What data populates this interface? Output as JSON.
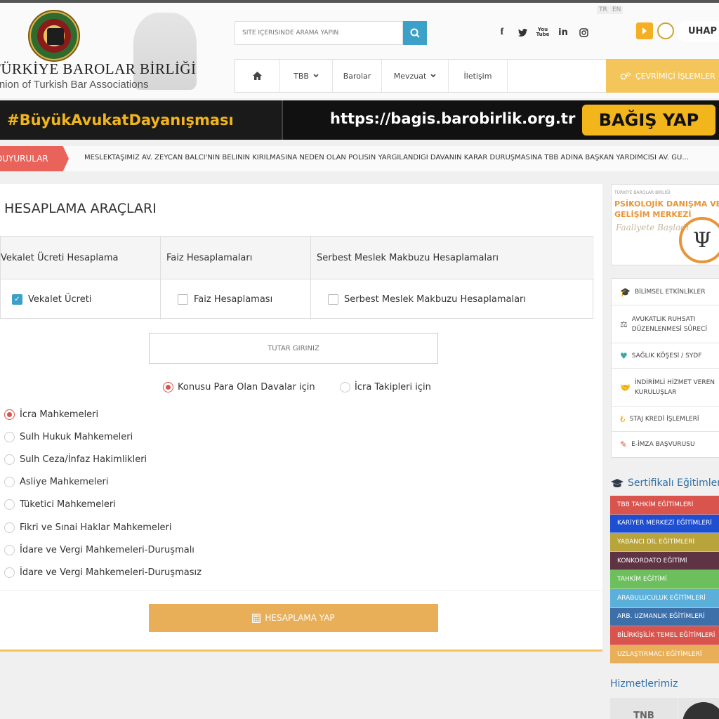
{
  "header": {
    "brand_title": "TÜRKİYE BAROLAR BİRLİĞİ",
    "brand_subtitle": "Union of Turkish Bar Associations",
    "lang": [
      "TR",
      "EN"
    ],
    "search_placeholder": "SİTE İÇERİSİNDE ARAMA YAPIN",
    "uhap_label": "UHAP GİRİŞ",
    "social_icons": [
      "facebook-icon",
      "twitter-icon",
      "youtube-icon",
      "linkedin-icon",
      "instagram-icon"
    ],
    "youtube_glyph": "You Tube",
    "linkedin_glyph": "in",
    "nav": [
      {
        "label": "",
        "icon": "home-icon"
      },
      {
        "label": "TBB",
        "dropdown": true
      },
      {
        "label": "Barolar"
      },
      {
        "label": "Mevzuat",
        "dropdown": true
      },
      {
        "label": "İletişim"
      }
    ],
    "online_label": "ÇEVRİMİÇİ İŞLEMLER"
  },
  "banner": {
    "hashtag": "#BüyükAvukatDayanışması",
    "url": "https://bagis.barobirlik.org.tr",
    "cta": "BAĞIŞ YAP"
  },
  "announcements": {
    "label": "DUYURULAR",
    "text": "MESLEKTAŞIMIZ AV. ZEYCAN BALCI'NIN BELİNİN KIRILMASINA NEDEN OLAN POLİSİN YARGILANDIĞI DAVANIN KARAR DURUŞMASINA TBB ADINA BAŞKAN YARDIMCISI AV. GÜ..."
  },
  "main": {
    "title": "HESAPLAMA ARAÇLARI",
    "columns": [
      "Vekalet Ücreti Hesaplama",
      "Faiz Hesaplamaları",
      "Serbest Meslek Makbuzu Hesaplamaları"
    ],
    "options": [
      {
        "label": "Vekalet Ücreti",
        "checked": true
      },
      {
        "label": "Faiz Hesaplaması",
        "checked": false
      },
      {
        "label": "Serbest Meslek Makbuzu Hesaplamaları",
        "checked": false
      }
    ],
    "amount_placeholder": "TUTAR GİRİNİZ",
    "case_types": [
      {
        "label": "Konusu Para Olan Davalar için",
        "selected": true
      },
      {
        "label": "İcra Takipleri için",
        "selected": false
      }
    ],
    "courts": [
      {
        "label": "İcra Mahkemeleri",
        "selected": true
      },
      {
        "label": "Sulh Hukuk Mahkemeleri",
        "selected": false
      },
      {
        "label": "Sulh Ceza/İnfaz Hakimlikleri",
        "selected": false
      },
      {
        "label": "Asliye Mahkemeleri",
        "selected": false
      },
      {
        "label": "Tüketici Mahkemeleri",
        "selected": false
      },
      {
        "label": "Fikri ve Sınai Haklar Mahkemeleri",
        "selected": false
      },
      {
        "label": "İdare ve Vergi Mahkemeleri-Duruşmalı",
        "selected": false
      },
      {
        "label": "İdare ve Vergi Mahkemeleri-Duruşmasız",
        "selected": false
      }
    ],
    "calc_button": "HESAPLAMA YAP"
  },
  "sidebar": {
    "ad": {
      "small": "TÜRKİYE BAROLAR BİRLİĞİ",
      "title": "PSİKOLOJİK DANIŞMA VE GELİŞİM MERKEZİ",
      "script": "Faaliyete Başladı",
      "symbol": "Ψ"
    },
    "menu": [
      {
        "label": "BİLİMSEL ETKİNLİKLER",
        "icon": "graduation-cap-icon"
      },
      {
        "label": "AVUKATLIK RUHSATI DÜZENLENMESİ SÜRECİ",
        "icon": "scales-icon"
      },
      {
        "label": "SAĞLIK KÖŞESİ / SYDF",
        "icon": "heart-pulse-icon"
      },
      {
        "label": "İNDİRİMLİ HİZMET VEREN KURULUŞLAR",
        "icon": "handshake-icon"
      },
      {
        "label": "STAJ KREDİ İŞLEMLERİ",
        "icon": "lira-icon"
      },
      {
        "label": "E-İMZA BAŞVURUSU",
        "icon": "pen-icon"
      }
    ],
    "cert_title": "Sertifikalı Eğitimler",
    "certs": [
      {
        "label": "TBB TAHKİM EĞİTİMLERİ",
        "color": "#d9544d"
      },
      {
        "label": "KARİYER MERKEZİ EĞİTİMLERİ",
        "color": "#1f4fd1"
      },
      {
        "label": "YABANCI DİL EĞİTİMLERİ",
        "color": "#b8a43a"
      },
      {
        "label": "KONKORDATO EĞİTİMİ",
        "color": "#5e3344"
      },
      {
        "label": "TAHKİM EĞİTİMİ",
        "color": "#6cbf5c"
      },
      {
        "label": "ARABULUCULUK EĞİTİMLERİ",
        "color": "#5bb0db"
      },
      {
        "label": "ARB. UZMANLIK EĞİTİMLERİ",
        "color": "#3d6fa8"
      },
      {
        "label": "BİLİRKİŞİLİK TEMEL EĞİTİMLERİ",
        "color": "#d9544d"
      },
      {
        "label": "UZLAŞTIRMACI EĞİTİMLERİ",
        "color": "#e8ae58"
      }
    ],
    "services_title": "Hizmetlerimiz",
    "services_thumb": "TNB"
  },
  "colors": {
    "accent_gold": "#f4c55a",
    "accent_blue": "#3da0c8",
    "alert_red": "#e9635a",
    "banner_yellow": "#f2b51c"
  }
}
